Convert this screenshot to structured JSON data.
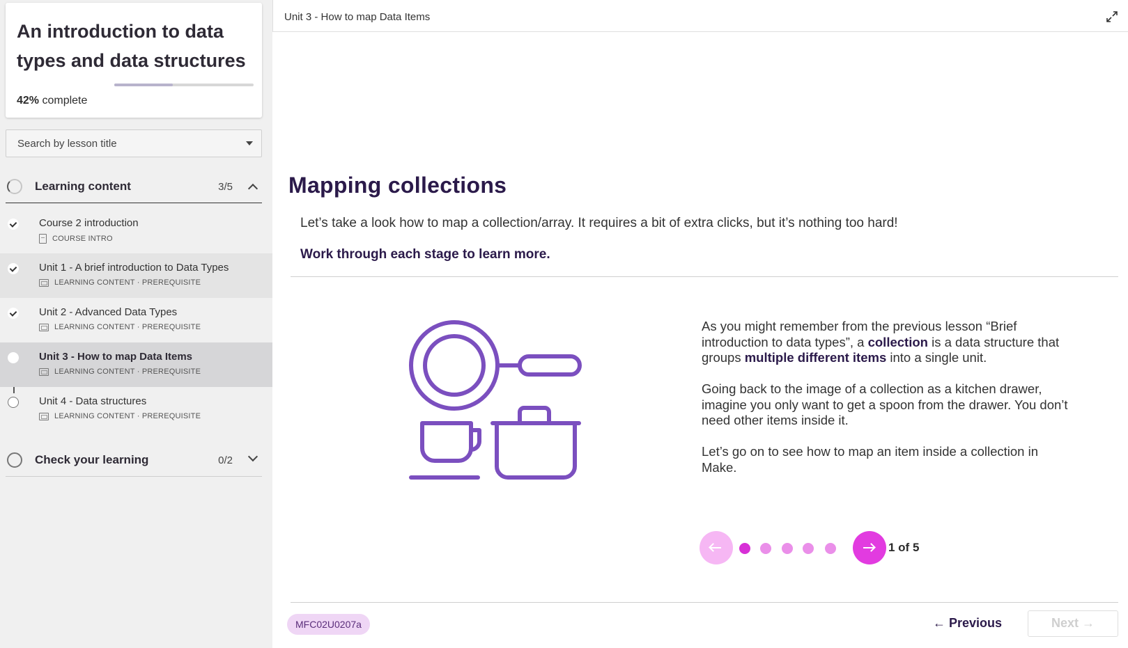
{
  "sidebar": {
    "course_title": "An introduction to data types and data structures",
    "progress": {
      "percent_label": "42%",
      "suffix": " complete",
      "value": 0.42
    },
    "search_placeholder": "Search by lesson title",
    "sections": [
      {
        "title": "Learning content",
        "count": "3/5",
        "expanded": true
      },
      {
        "title": "Check your learning",
        "count": "0/2",
        "expanded": false
      }
    ],
    "lessons": [
      {
        "title": "Course 2 introduction",
        "meta": "COURSE INTRO",
        "icon": "document-icon",
        "status": "done"
      },
      {
        "title": "Unit 1 - A brief introduction to Data Types",
        "meta": "LEARNING CONTENT · PREREQUISITE",
        "icon": "slides-icon",
        "status": "done"
      },
      {
        "title": "Unit 2 - Advanced Data Types",
        "meta": "LEARNING CONTENT · PREREQUISITE",
        "icon": "slides-icon",
        "status": "done"
      },
      {
        "title": "Unit 3 - How to map Data Items",
        "meta": "LEARNING CONTENT · PREREQUISITE",
        "icon": "slides-icon",
        "status": "current"
      },
      {
        "title": "Unit 4 - Data structures",
        "meta": "LEARNING CONTENT · PREREQUISITE",
        "icon": "slides-icon",
        "status": "todo"
      }
    ]
  },
  "main": {
    "header_title": "Unit 3 - How to map Data Items",
    "heading": "Mapping collections",
    "intro": "Let’s take a look how to map a collection/array. It requires a bit of extra clicks, but it’s nothing too hard!",
    "instruction": "Work through each stage to learn more.",
    "illustration": "kitchen-utensils-icon",
    "body": {
      "p1_a": "As you might remember from the previous lesson “Brief introduction to data types”, a ",
      "p1_b": "collection",
      "p1_c": " is a data structure that groups ",
      "p1_d": "multiple different items",
      "p1_e": " into a single unit.",
      "p2": "Going back to the image of a collection as a kitchen drawer, imagine you only want to get a spoon from the drawer. You don’t need other items inside it.",
      "p3": "Let’s go on to see how to map an item inside a collection in Make."
    },
    "carousel": {
      "current": 1,
      "total": 5,
      "label": "1 of 5"
    },
    "footer": {
      "code": "MFC02U0207a",
      "previous_label": "Previous",
      "next_label": "Next"
    }
  },
  "colors": {
    "accent": "#e23be0",
    "accent_light": "#f6b7f4",
    "heading": "#2b1a4a",
    "illustration": "#7b4fbf"
  }
}
